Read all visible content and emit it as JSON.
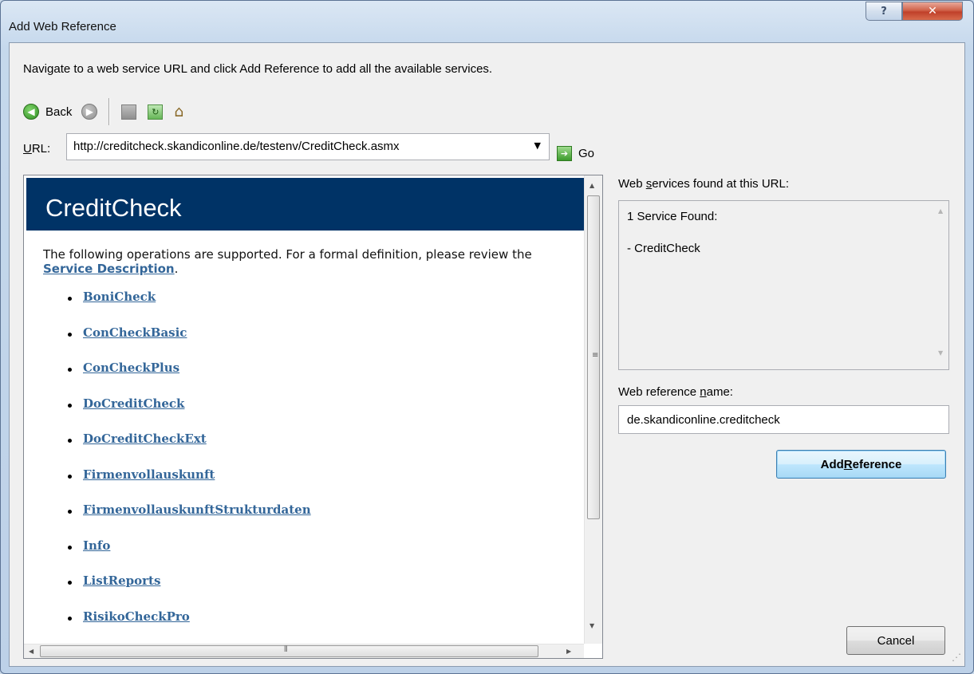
{
  "window": {
    "title": "Add Web Reference",
    "help_glyph": "?",
    "close_glyph": "✕"
  },
  "instruction": "Navigate to a web service URL and click Add Reference to add all the available services.",
  "toolbar": {
    "back_label": "Back",
    "back_icon": "arrow-left-icon",
    "forward_icon": "arrow-right-icon",
    "stop_icon": "stop-icon",
    "refresh_icon": "refresh-icon",
    "home_icon": "home-icon"
  },
  "url": {
    "label_accel": "U",
    "label_rest": "RL:",
    "value": "http://creditcheck.skandiconline.de/testenv/CreditCheck.asmx",
    "go_label": "Go"
  },
  "browser": {
    "title": "CreditCheck",
    "intro_text": "The following operations are supported. For a formal definition, please review the ",
    "intro_link": "Service Description",
    "intro_end": ".",
    "operations": [
      "BoniCheck",
      "ConCheckBasic",
      "ConCheckPlus",
      "DoCreditCheck",
      "DoCreditCheckExt",
      "Firmenvollauskunft",
      "FirmenvollauskunftStrukturdaten",
      "Info",
      "ListReports",
      "RisikoCheckPro"
    ]
  },
  "services": {
    "label_pre": "Web ",
    "label_accel": "s",
    "label_post": "ervices found at this URL:",
    "count_text": "1 Service Found:",
    "items": [
      "- CreditCheck"
    ]
  },
  "reference": {
    "label_pre": "Web reference ",
    "label_accel": "n",
    "label_post": "ame:",
    "value": "de.skandiconline.creditcheck",
    "add_pre": "Add ",
    "add_accel": "R",
    "add_post": "eference",
    "cancel_label": "Cancel"
  }
}
